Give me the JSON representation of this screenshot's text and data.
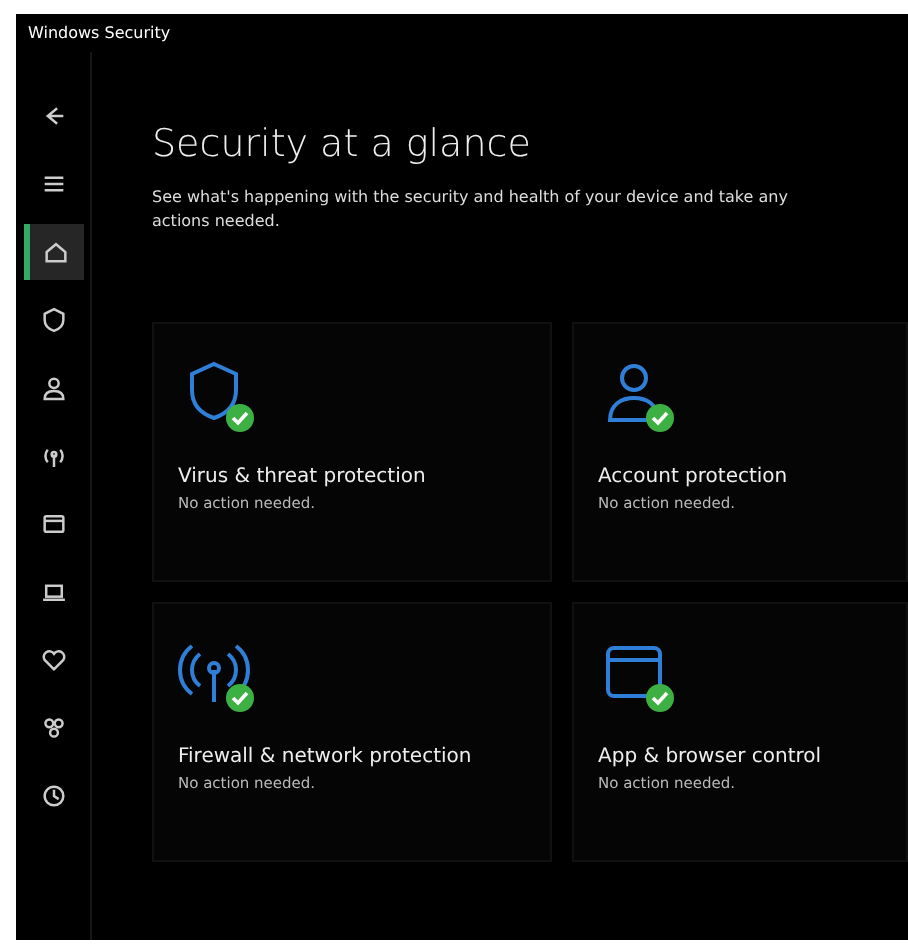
{
  "window": {
    "title": "Windows Security"
  },
  "sidebar": {
    "items": [
      {
        "kind": "back",
        "selected": false
      },
      {
        "kind": "menu",
        "selected": false
      },
      {
        "kind": "home",
        "selected": true
      },
      {
        "kind": "shield",
        "selected": false
      },
      {
        "kind": "person",
        "selected": false
      },
      {
        "kind": "wifi",
        "selected": false
      },
      {
        "kind": "window",
        "selected": false
      },
      {
        "kind": "laptop",
        "selected": false
      },
      {
        "kind": "heart",
        "selected": false
      },
      {
        "kind": "family",
        "selected": false
      },
      {
        "kind": "history",
        "selected": false
      }
    ]
  },
  "page": {
    "title": "Security at a glance",
    "description": "See what's happening with the security and health of your device and take any actions needed."
  },
  "cards": [
    {
      "kind": "shield",
      "title": "Virus & threat protection",
      "status": "No action needed."
    },
    {
      "kind": "person",
      "title": "Account protection",
      "status": "No action needed."
    },
    {
      "kind": "wifi",
      "title": "Firewall & network protection",
      "status": "No action needed."
    },
    {
      "kind": "window",
      "title": "App & browser control",
      "status": "No action needed."
    }
  ]
}
